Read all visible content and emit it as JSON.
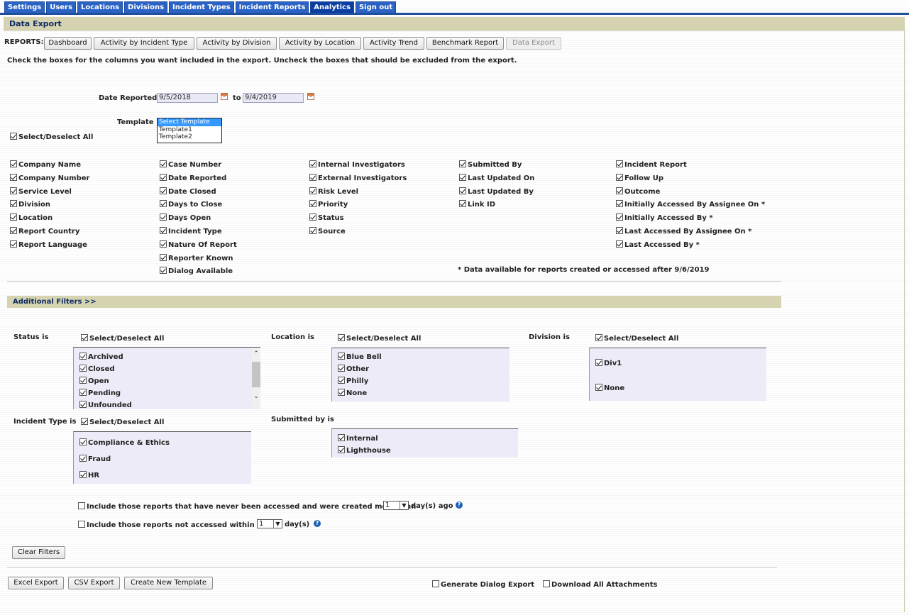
{
  "nav": {
    "tabs": [
      "Settings",
      "Users",
      "Locations",
      "Divisions",
      "Incident Types",
      "Incident Reports",
      "Analytics",
      "Sign out"
    ],
    "active_tab": "Analytics"
  },
  "header": {
    "title": "Data Export"
  },
  "reports": {
    "label": "REPORTS:",
    "buttons": [
      "Dashboard",
      "Activity by Incident Type",
      "Activity by Division",
      "Activity by Location",
      "Activity Trend",
      "Benchmark Report",
      "Data Export"
    ]
  },
  "instructions": "Check the boxes for the columns you want included in the export. Uncheck the boxes that should be excluded from the export.",
  "date_reported": {
    "label": "Date Reported",
    "from": "9/5/2018",
    "to_label": "to",
    "to": "9/4/2019"
  },
  "template": {
    "label": "Template",
    "options": [
      "Select Template",
      "Template1",
      "Template2"
    ],
    "selected": "Select Template"
  },
  "select_all": {
    "label": "Select/Deselect All",
    "checked": true
  },
  "columns": {
    "col1": [
      "Company Name",
      "Company Number",
      "Service Level",
      "Division",
      "Location",
      "Report Country",
      "Report Language"
    ],
    "col2": [
      "Case Number",
      "Date Reported",
      "Date Closed",
      "Days to Close",
      "Days Open",
      "Incident Type",
      "Nature Of Report",
      "Reporter Known",
      "Dialog Available"
    ],
    "col3": [
      "Internal Investigators",
      "External Investigators",
      "Risk Level",
      "Priority",
      "Status",
      "Source"
    ],
    "col4": [
      "Submitted By",
      "Last Updated On",
      "Last Updated By",
      "Link ID"
    ],
    "col5": [
      "Incident Report",
      "Follow Up",
      "Outcome",
      "Initially Accessed By Assignee On *",
      "Initially Accessed By *",
      "Last Accessed By Assignee On *",
      "Last Accessed By *"
    ]
  },
  "data_note": "* Data available for reports created or accessed after 9/6/2019",
  "additional_filters": {
    "title": "Additional Filters >>",
    "select_all_label": "Select/Deselect All",
    "status": {
      "label": "Status is",
      "items": [
        "Archived",
        "Closed",
        "Open",
        "Pending",
        "Unfounded"
      ]
    },
    "location": {
      "label": "Location is",
      "items": [
        "Blue Bell",
        "Other",
        "Philly",
        "None"
      ]
    },
    "division": {
      "label": "Division is",
      "items": [
        "Div1",
        "None"
      ]
    },
    "incident_type": {
      "label": "Incident Type is",
      "items": [
        "Compliance & Ethics",
        "Fraud",
        "HR"
      ]
    },
    "submitted_by": {
      "label": "Submitted by is",
      "items": [
        "Internal",
        "Lighthouse"
      ]
    }
  },
  "never_accessed": {
    "label": "Include those reports that have never been accessed and were created more than",
    "value": "1",
    "suffix": "day(s) ago",
    "checked": false
  },
  "not_accessed": {
    "label": "Include those reports not accessed within past",
    "value": "1",
    "suffix": "day(s)",
    "checked": false
  },
  "clear_filters_label": "Clear Filters",
  "footer": {
    "excel_export": "Excel Export",
    "csv_export": "CSV Export",
    "create_template": "Create New Template",
    "dialog_export": {
      "label": "Generate Dialog Export",
      "checked": false
    },
    "download_attachments": {
      "label": "Download All Attachments",
      "checked": false
    }
  },
  "colors": {
    "nav_tab": "#2b63c4",
    "header_bg": "#d6d4b0",
    "header_text": "#0c2a66",
    "listbox_bg": "#ecebf7"
  }
}
